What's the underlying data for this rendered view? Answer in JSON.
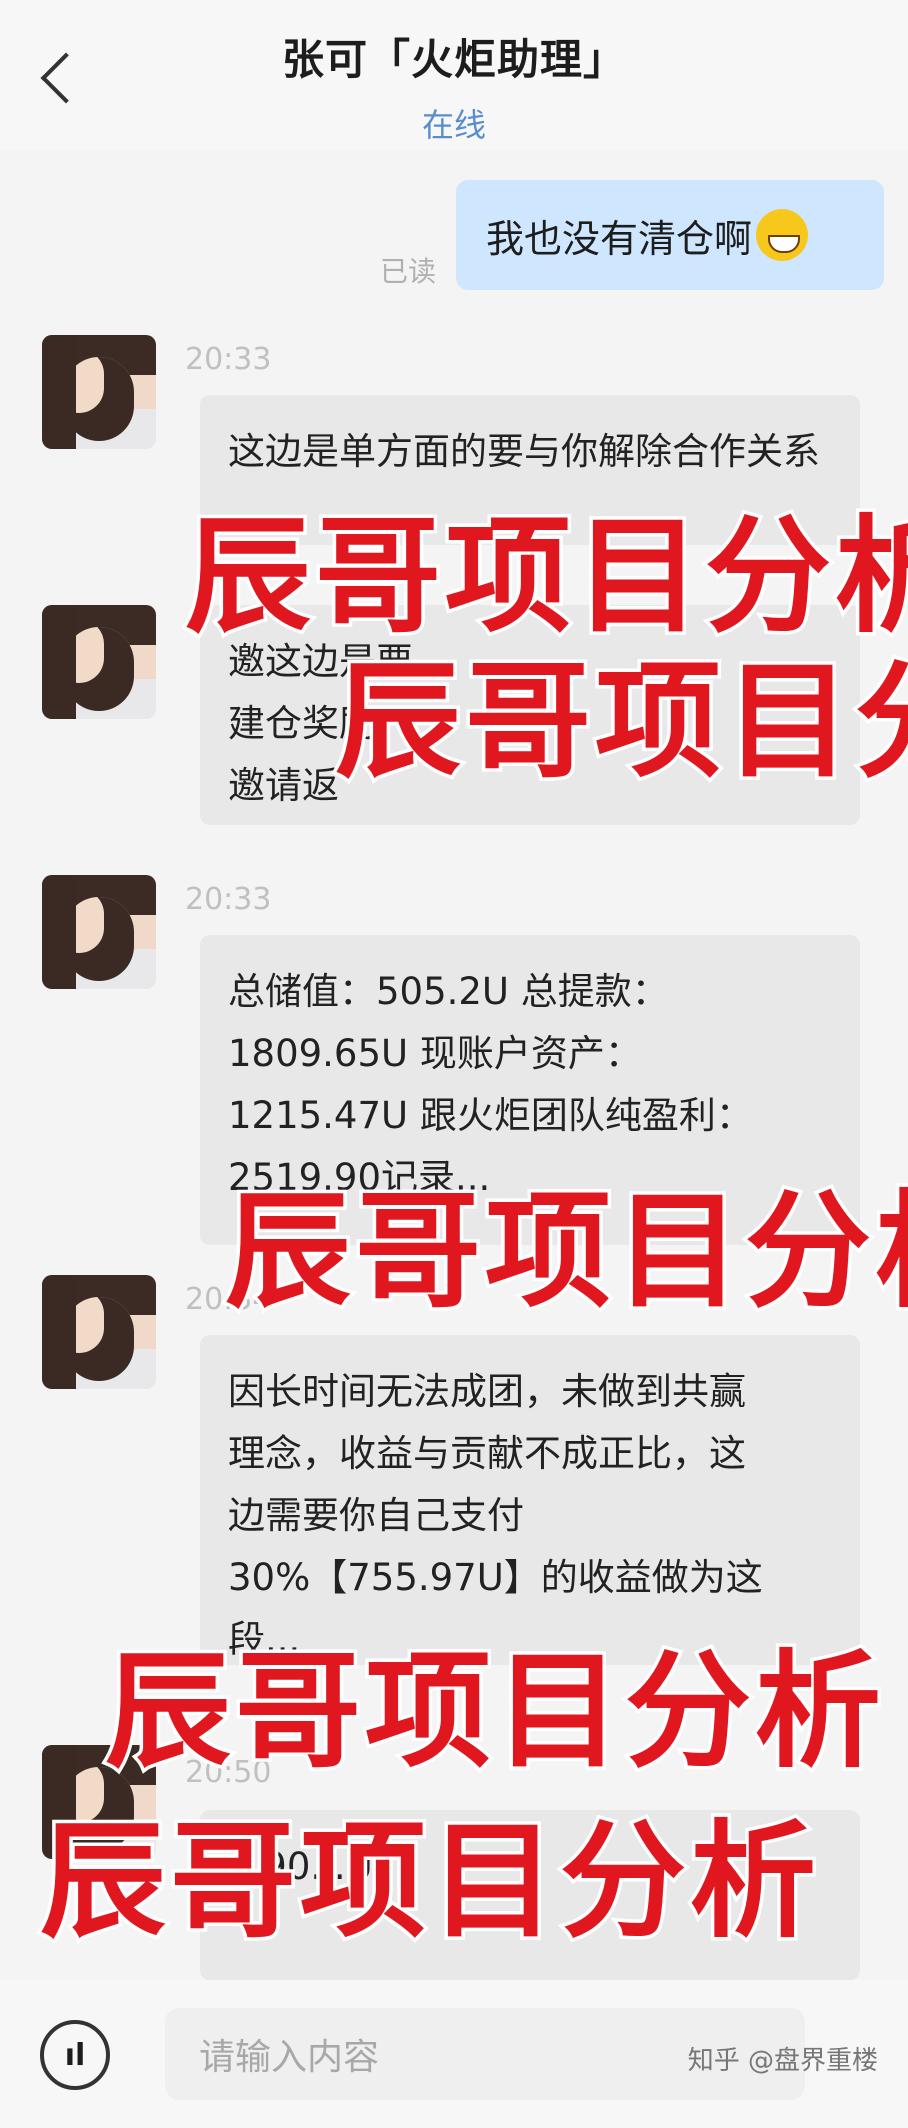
{
  "header": {
    "title": "张可「火炬助理」",
    "status": "在线"
  },
  "my_message": {
    "text": "我也没有清仓啊",
    "read_label": "已读"
  },
  "messages": [
    {
      "time": "20:33",
      "text": "这边是单方面的要与你解除合作关系"
    },
    {
      "time": "",
      "text": "邀这边是要\n建仓奖励\n邀请返"
    },
    {
      "time": "20:33",
      "text": "总储值：505.2U  总提款：\n1809.65U  现账户资产：\n1215.47U  跟火炬团队纯盈利：\n2519.90记录..."
    },
    {
      "time": "20:34",
      "text": "因长时间无法成团，未做到共赢\n理念，收益与贡献不成正比，这\n边需要你自己支付\n30%【755.97U】的收益做为这\n段..."
    },
    {
      "time": "20:50",
      "text": "...90...U"
    }
  ],
  "overlay_text": "辰哥项目分析",
  "input": {
    "placeholder": "请输入内容"
  },
  "watermark": "知乎 @盘界重楼"
}
